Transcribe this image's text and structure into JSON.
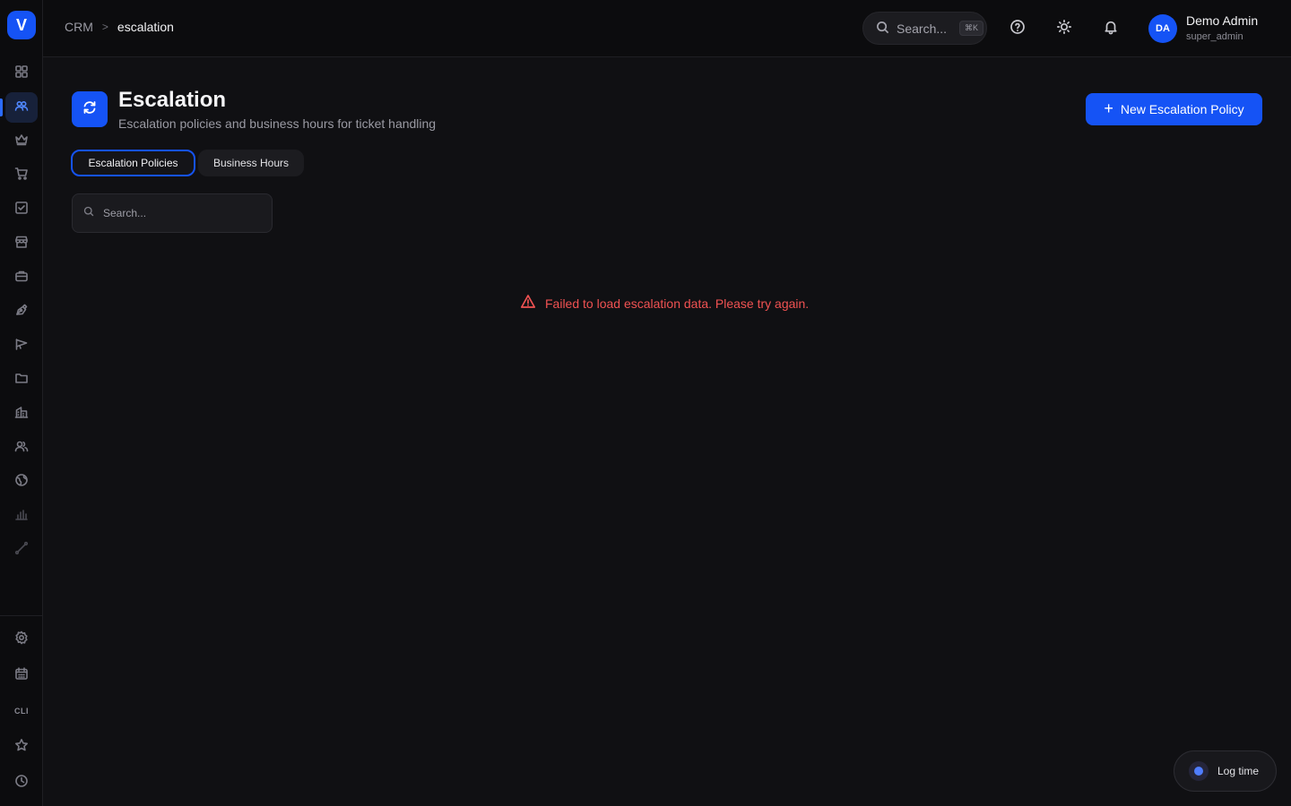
{
  "app": {
    "logo_letter": "V"
  },
  "header": {
    "breadcrumb": {
      "root": "CRM",
      "separator": ">",
      "current": "escalation"
    },
    "search": {
      "label": "Search...",
      "shortcut": "⌘K"
    },
    "user": {
      "initials": "DA",
      "name": "Demo Admin",
      "role": "super_admin"
    }
  },
  "sidebar": {
    "items": [
      {
        "icon": "dashboard-grid-icon"
      },
      {
        "icon": "users-icon",
        "active": true
      },
      {
        "icon": "crown-icon"
      },
      {
        "icon": "shopping-cart-icon"
      },
      {
        "icon": "checkbox-icon"
      },
      {
        "icon": "store-icon"
      },
      {
        "icon": "briefcase-icon"
      },
      {
        "icon": "pen-tool-icon"
      },
      {
        "icon": "megaphone-icon"
      },
      {
        "icon": "folder-icon"
      },
      {
        "icon": "building-icon"
      },
      {
        "icon": "team-icon"
      },
      {
        "icon": "globe-icon"
      },
      {
        "icon": "bar-chart-icon"
      },
      {
        "icon": "route-icon"
      }
    ],
    "bottom": [
      {
        "icon": "settings-gear-icon"
      },
      {
        "icon": "calendar-icon"
      },
      {
        "icon": "cli-icon",
        "label": "CLI"
      },
      {
        "icon": "star-icon"
      },
      {
        "icon": "clock-icon"
      }
    ]
  },
  "main": {
    "title": "Escalation",
    "subtitle": "Escalation policies and business hours for ticket handling",
    "new_button_label": "New Escalation Policy",
    "tabs": [
      {
        "label": "Escalation Policies",
        "active": true
      },
      {
        "label": "Business Hours",
        "active": false
      }
    ],
    "search_placeholder": "Search...",
    "error_message": "Failed to load escalation data. Please try again."
  },
  "floating": {
    "log_time_label": "Log time"
  },
  "colors": {
    "accent": "#1553f5",
    "error": "#f05252",
    "background": "#101013"
  }
}
